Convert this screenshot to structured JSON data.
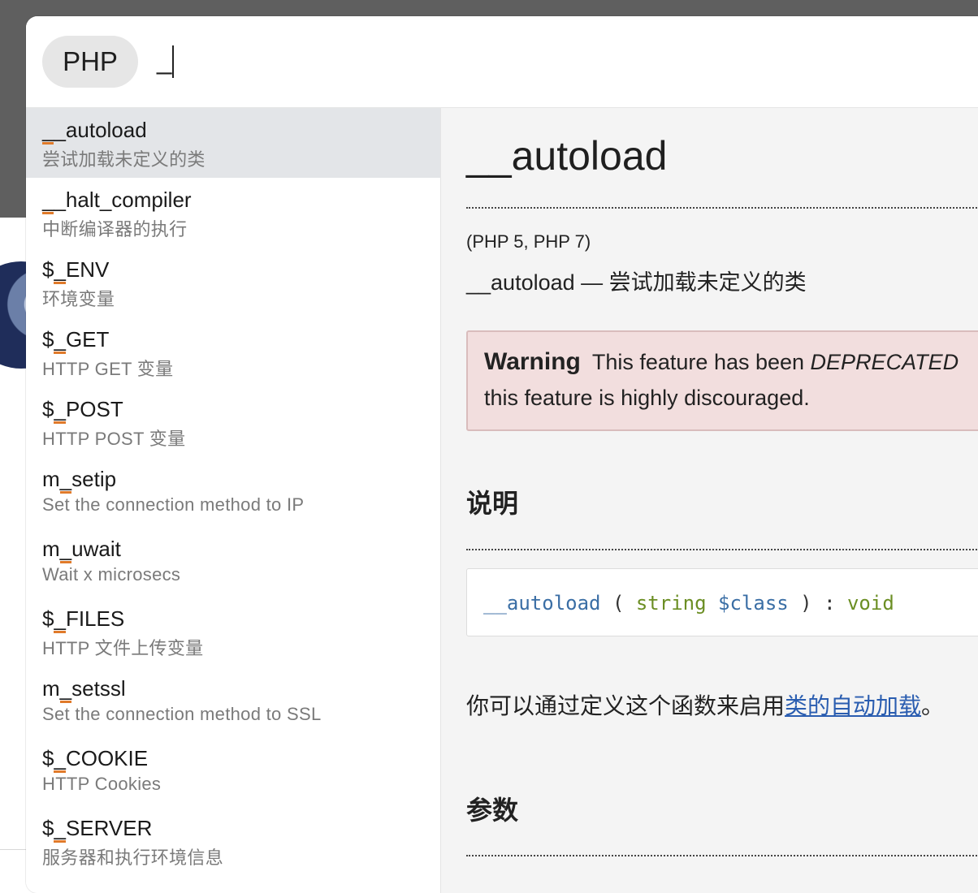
{
  "search": {
    "scope": "PHP",
    "query": "_"
  },
  "results": [
    {
      "title": "__autoload",
      "subtitle": "尝试加载未定义的类",
      "selected": true
    },
    {
      "title": "__halt_compiler",
      "subtitle": "中断编译器的执行",
      "selected": false
    },
    {
      "title": "$_ENV",
      "subtitle": "环境变量",
      "selected": false
    },
    {
      "title": "$_GET",
      "subtitle": "HTTP GET 变量",
      "selected": false
    },
    {
      "title": "$_POST",
      "subtitle": "HTTP POST 变量",
      "selected": false
    },
    {
      "title": "m_setip",
      "subtitle": "Set the connection method to IP",
      "selected": false
    },
    {
      "title": "m_uwait",
      "subtitle": "Wait x microsecs",
      "selected": false
    },
    {
      "title": "$_FILES",
      "subtitle": "HTTP 文件上传变量",
      "selected": false
    },
    {
      "title": "m_setssl",
      "subtitle": "Set the connection method to SSL",
      "selected": false
    },
    {
      "title": "$_COOKIE",
      "subtitle": "HTTP Cookies",
      "selected": false
    },
    {
      "title": "$_SERVER",
      "subtitle": "服务器和执行环境信息",
      "selected": false
    }
  ],
  "doc": {
    "title": "__autoload",
    "versions": "(PHP 5, PHP 7)",
    "refname": "__autoload — 尝试加载未定义的类",
    "warning": {
      "label": "Warning",
      "text_before": "This feature has been ",
      "text_em": "DEPRECATED",
      "line2": "this feature is highly discouraged."
    },
    "section_description": "说明",
    "signature": {
      "fn": "__autoload",
      "open": "(",
      "type": "string",
      "param": "$class",
      "close": ")",
      "colon": ":",
      "ret": "void"
    },
    "desc_text": "你可以通过定义这个函数来启用",
    "desc_link": "类的自动加载",
    "desc_end": "。",
    "section_parameters": "参数"
  },
  "colors": {
    "accent_underline": "#e07a2a",
    "warning_bg": "#f2dede",
    "link": "#2a5db0",
    "code_function": "#3a6ea5",
    "code_type": "#6b8e23"
  }
}
